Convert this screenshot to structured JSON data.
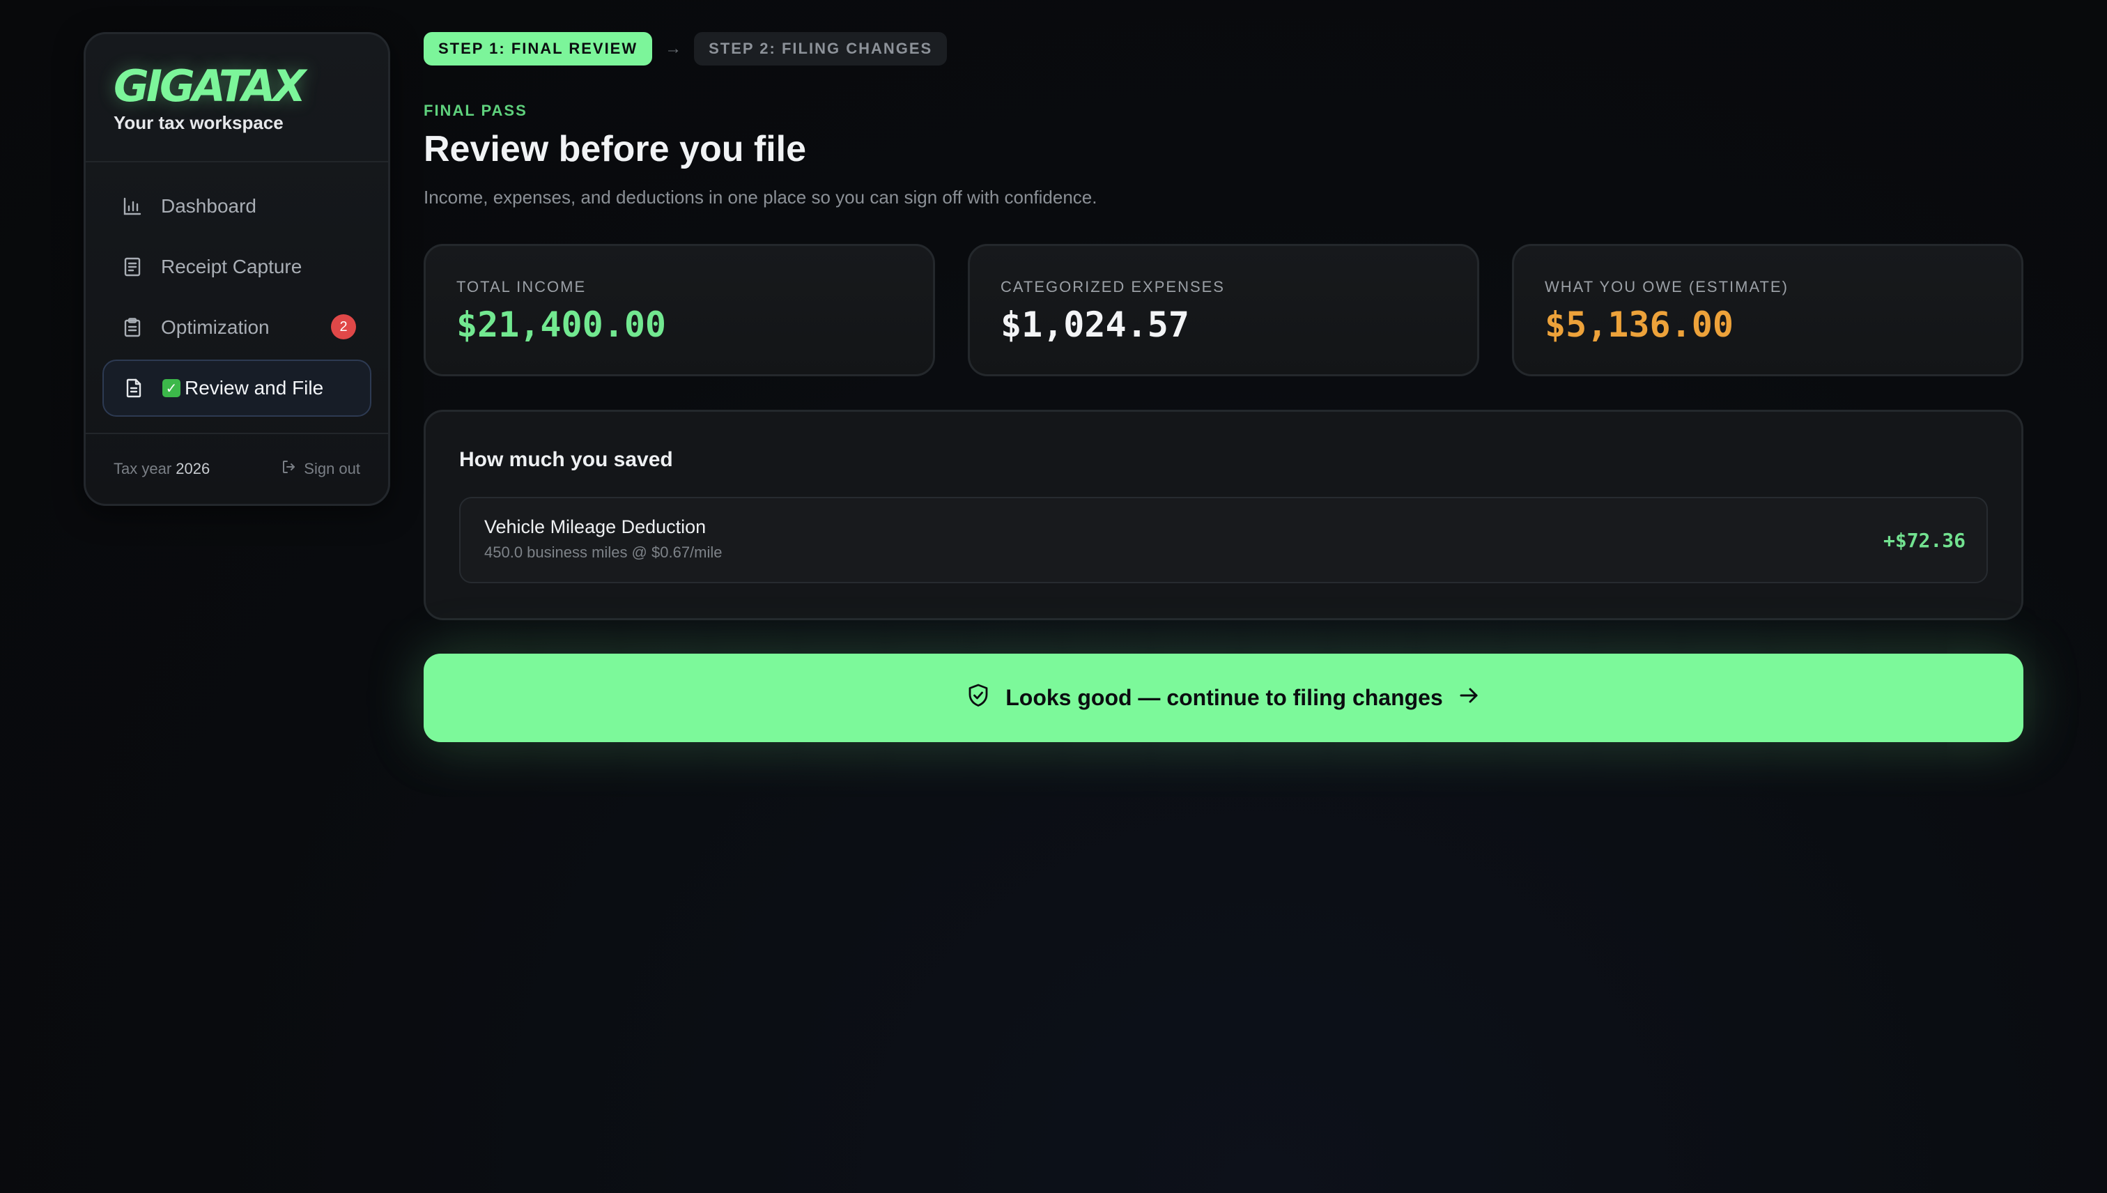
{
  "brand": {
    "logo": "GIGATAX",
    "tagline": "Your tax workspace"
  },
  "sidebar": {
    "items": [
      {
        "label": "Dashboard",
        "icon": "bar-chart-icon"
      },
      {
        "label": "Receipt Capture",
        "icon": "receipt-icon"
      },
      {
        "label": "Optimization",
        "icon": "clipboard-icon",
        "badge": "2"
      },
      {
        "label": "Review and File",
        "icon": "document-icon",
        "active": true
      }
    ],
    "footer": {
      "tax_year_label": "Tax year",
      "tax_year": "2026",
      "sign_out": "Sign out"
    }
  },
  "steps": [
    {
      "label": "STEP 1: FINAL REVIEW",
      "active": true
    },
    {
      "label": "STEP 2: FILING CHANGES",
      "active": false
    }
  ],
  "header": {
    "eyebrow": "FINAL PASS",
    "title": "Review before you file",
    "subtitle": "Income, expenses, and deductions in one place so you can sign off with confidence."
  },
  "stats": [
    {
      "label": "TOTAL INCOME",
      "value": "$21,400.00",
      "color": "#72e890"
    },
    {
      "label": "CATEGORIZED EXPENSES",
      "value": "$1,024.57",
      "color": "#f3f4f6"
    },
    {
      "label": "WHAT YOU OWE (ESTIMATE)",
      "value": "$5,136.00",
      "color": "#eda23a"
    }
  ],
  "savings": {
    "title": "How much you saved",
    "items": [
      {
        "title": "Vehicle Mileage Deduction",
        "detail": "450.0 business miles @ $0.67/mile",
        "amount": "+$72.36"
      }
    ]
  },
  "cta": {
    "label": "Looks good — continue to filing changes",
    "icon": "shield-check-icon"
  },
  "colors": {
    "accent": "#7cf59a",
    "warning": "#eda23a",
    "badge": "#e04848"
  }
}
